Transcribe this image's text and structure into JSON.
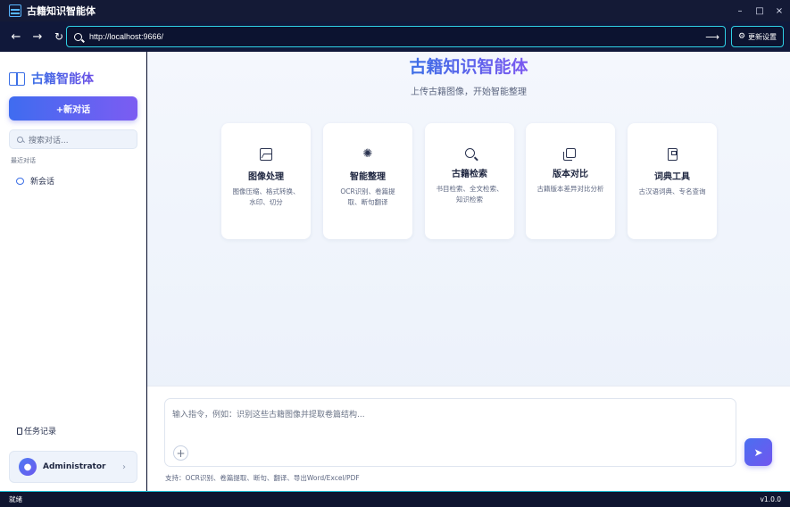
{
  "window": {
    "title": "古籍知识智能体",
    "controls": {
      "minimize": "–",
      "maximize": "□",
      "close": "×"
    }
  },
  "addressbar": {
    "back": "←",
    "forward": "→",
    "reload": "↻",
    "url": "http://localhost:9666/",
    "go": "⟶",
    "update_label": "更新设置",
    "update_icon": "⚙"
  },
  "sidebar": {
    "brand": "古籍智能体",
    "new_chat": "+新对话",
    "search_placeholder": "搜索对话...",
    "recent_label": "最近对话",
    "sessions": [
      "新会话"
    ],
    "tasks_label": "任务记录",
    "user": {
      "name": "Administrator",
      "avatar_icon": "person-icon"
    }
  },
  "main": {
    "title": "古籍知识智能体",
    "subtitle": "上传古籍图像，开始智能整理",
    "cards": [
      {
        "icon": "image-icon",
        "title": "图像处理",
        "desc": "图像压缩、格式转换、水印、切分"
      },
      {
        "icon": "sparkle-icon",
        "title": "智能整理",
        "desc": "OCR识别、卷篇提取、断句翻译"
      },
      {
        "icon": "search-icon",
        "title": "古籍检索",
        "desc": "书目检索、全文检索、知识检索"
      },
      {
        "icon": "copy-icon",
        "title": "版本对比",
        "desc": "古籍版本差异对比分析"
      },
      {
        "icon": "dictionary-icon",
        "title": "词典工具",
        "desc": "古汉语词典、专名查询"
      }
    ],
    "input_placeholder": "输入指令，例如：识别这些古籍图像并提取卷篇结构...",
    "attach": "+",
    "send_icon": "send-icon",
    "support_text": "支持：OCR识别、卷篇提取、断句、翻译、导出Word/Excel/PDF"
  },
  "statusbar": {
    "status": "就绪",
    "version": "v1.0.0"
  },
  "colors": {
    "accent": "#3b6fe6",
    "accent2": "#7c5cf2",
    "chrome": "#10183a",
    "focus": "#2fd0e5"
  }
}
